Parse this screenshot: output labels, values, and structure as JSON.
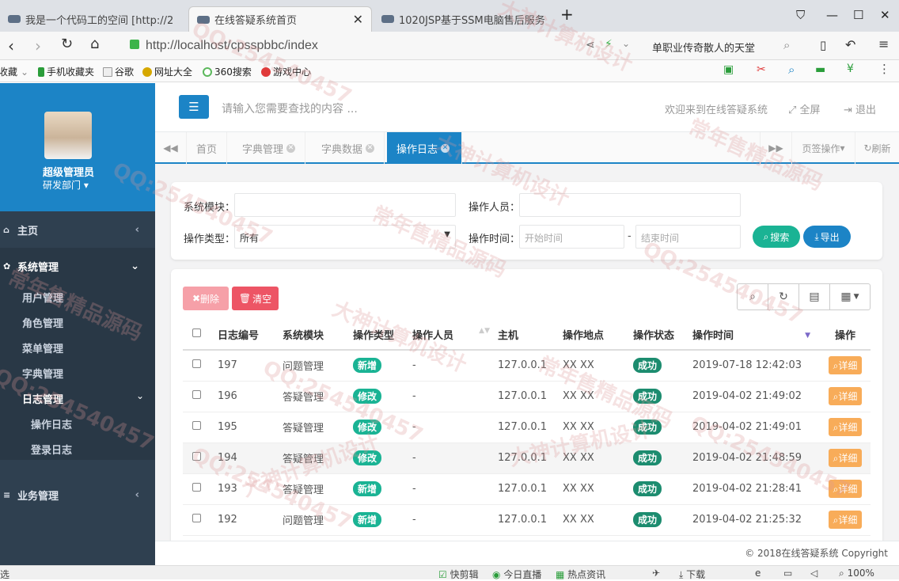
{
  "browser": {
    "tabs": [
      {
        "title": "我是一个代码工的空间 [http://2"
      },
      {
        "title": "在线答疑系统首页"
      },
      {
        "title": "1020JSP基于SSM电脑售后服务"
      }
    ],
    "url": "http://localhost/cpsspbbc/index",
    "search_engine": "单职业传奇散人的天堂",
    "bookmarks": [
      "收藏",
      "手机收藏夹",
      "谷歌",
      "网址大全",
      "360搜索",
      "游戏中心"
    ]
  },
  "sidebar": {
    "user_name": "超级管理员",
    "dept": "研发部门",
    "menu": {
      "home": "主页",
      "system": "系统管理",
      "business": "业务管理"
    },
    "sub": [
      "用户管理",
      "角色管理",
      "菜单管理",
      "字典管理",
      "日志管理"
    ],
    "log_sub": [
      "操作日志",
      "登录日志"
    ]
  },
  "topnav": {
    "search_placeholder": "请输入您需要查找的内容 ...",
    "welcome": "欢迎来到在线答疑系统",
    "fullscreen": "全屏",
    "logout": "退出"
  },
  "pagetabs": {
    "items": [
      "首页",
      "字典管理",
      "字典数据",
      "操作日志"
    ],
    "tab_ops": "页签操作",
    "refresh": "刷新"
  },
  "filter": {
    "module_label": "系统模块：",
    "operator_label": "操作人员：",
    "type_label": "操作类型：",
    "type_value": "所有",
    "time_label": "操作时间：",
    "start_placeholder": "开始时间",
    "dash": "-",
    "end_placeholder": "结束时间",
    "search_btn": "搜索",
    "export_btn": "导出"
  },
  "toolbar": {
    "delete": "删除",
    "clear": "清空"
  },
  "table": {
    "headers": [
      "日志编号",
      "系统模块",
      "操作类型",
      "操作人员",
      "主机",
      "操作地点",
      "操作状态",
      "操作时间",
      "操作"
    ],
    "rows": [
      {
        "id": "197",
        "module": "问题管理",
        "type": "新增",
        "user": "-",
        "host": "127.0.0.1",
        "loc": "XX XX",
        "status": "成功",
        "time": "2019-07-18 12:42:03",
        "action": "详细"
      },
      {
        "id": "196",
        "module": "答疑管理",
        "type": "修改",
        "user": "-",
        "host": "127.0.0.1",
        "loc": "XX XX",
        "status": "成功",
        "time": "2019-04-02 21:49:02",
        "action": "详细"
      },
      {
        "id": "195",
        "module": "答疑管理",
        "type": "修改",
        "user": "-",
        "host": "127.0.0.1",
        "loc": "XX XX",
        "status": "成功",
        "time": "2019-04-02 21:49:01",
        "action": "详细"
      },
      {
        "id": "194",
        "module": "答疑管理",
        "type": "修改",
        "user": "-",
        "host": "127.0.0.1",
        "loc": "XX XX",
        "status": "成功",
        "time": "2019-04-02 21:48:59",
        "action": "详细"
      },
      {
        "id": "193",
        "module": "答疑管理",
        "type": "新增",
        "user": "-",
        "host": "127.0.0.1",
        "loc": "XX XX",
        "status": "成功",
        "time": "2019-04-02 21:28:41",
        "action": "详细"
      },
      {
        "id": "192",
        "module": "问题管理",
        "type": "新增",
        "user": "-",
        "host": "127.0.0.1",
        "loc": "XX XX",
        "status": "成功",
        "time": "2019-04-02 21:25:32",
        "action": "详细"
      }
    ]
  },
  "footer": "© 2018在线答疑系统 Copyright",
  "statusbar": {
    "left": "选",
    "items": [
      "快剪辑",
      "今日直播",
      "热点资讯",
      "下载",
      "100%"
    ]
  },
  "watermarks": [
    "QQ:254540457",
    "大神计算机设计",
    "常年售精品源码"
  ]
}
